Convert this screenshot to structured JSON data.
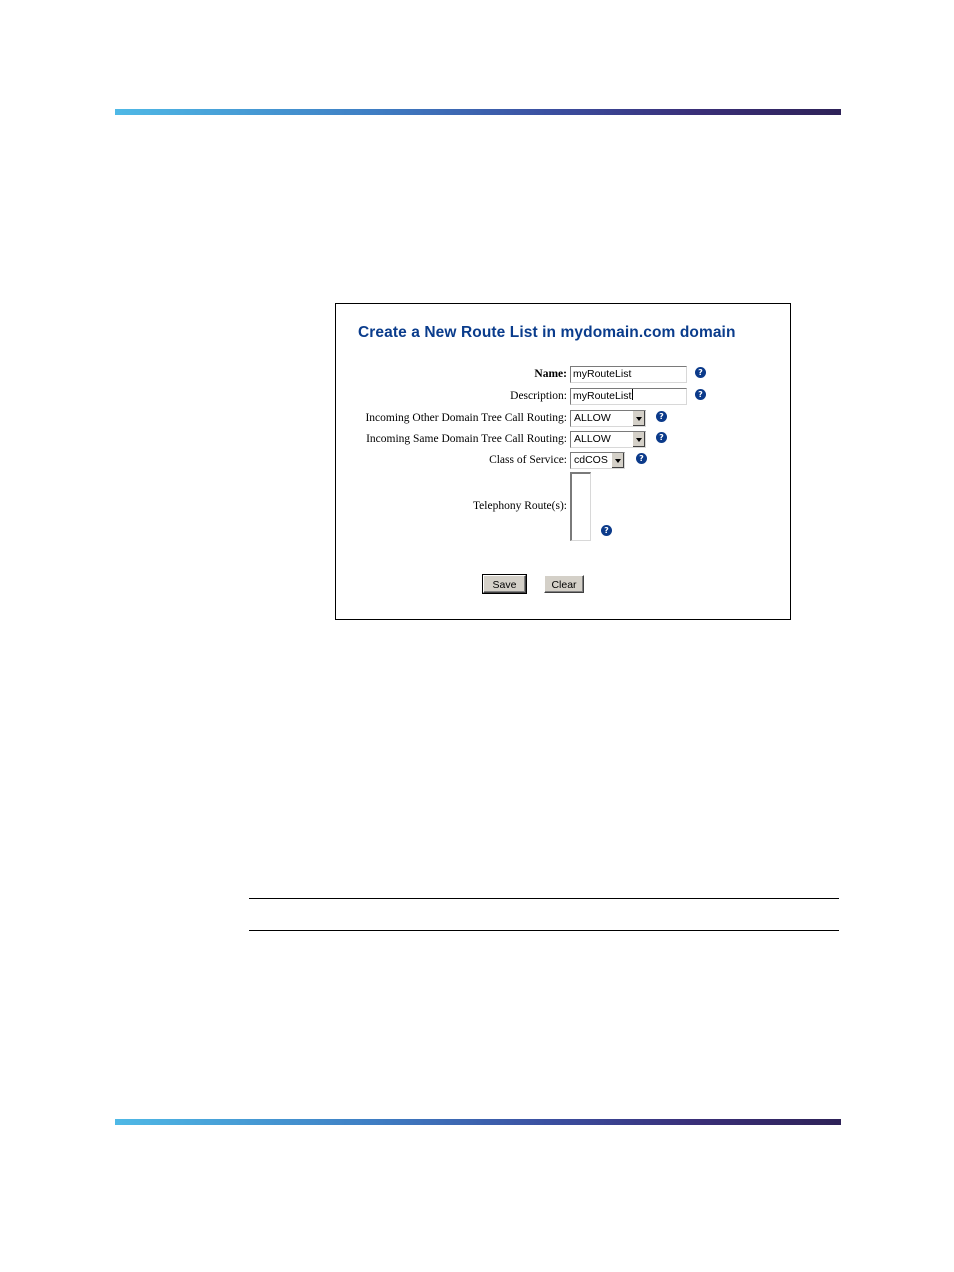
{
  "form": {
    "title": "Create a New Route List in mydomain.com domain",
    "fields": {
      "name": {
        "label": "Name:",
        "value": "myRouteList"
      },
      "description": {
        "label": "Description:",
        "value": "myRouteList"
      },
      "incoming_other": {
        "label": "Incoming Other Domain Tree Call Routing:",
        "value": "ALLOW"
      },
      "incoming_same": {
        "label": "Incoming Same Domain Tree Call Routing:",
        "value": "ALLOW"
      },
      "class_of_service": {
        "label": "Class of Service:",
        "value": "cdCOS"
      },
      "telephony_routes": {
        "label": "Telephony Route(s):"
      }
    },
    "help_glyph": "?",
    "buttons": {
      "save": "Save",
      "clear": "Clear"
    }
  },
  "icons": {
    "help": "help-icon",
    "dropdown": "chevron-down-icon"
  },
  "colors": {
    "title": "#0a3c8c",
    "help_icon": "#0b3a8a",
    "rule_gradient_start": "#4fb9e6",
    "rule_gradient_end": "#2e2258"
  }
}
